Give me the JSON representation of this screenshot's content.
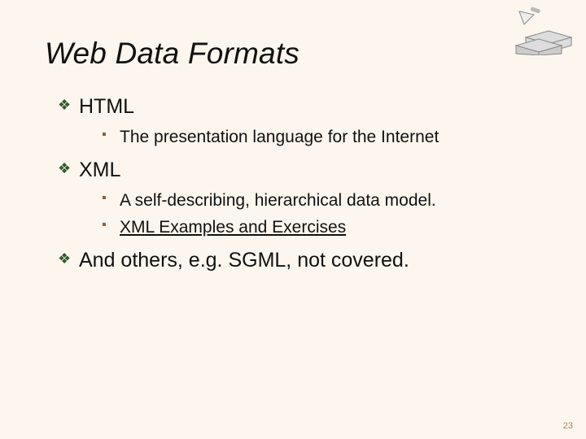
{
  "title": "Web Data Formats",
  "bullets": [
    {
      "text": "HTML",
      "sub": [
        {
          "text": "The presentation language for the Internet"
        }
      ]
    },
    {
      "text": "XML",
      "sub": [
        {
          "text": "A self-describing, hierarchical data model."
        },
        {
          "text": "XML Examples and Exercises",
          "link": true
        }
      ]
    },
    {
      "text": "And others, e.g. SGML, not covered.",
      "sub": []
    }
  ],
  "pageNumber": "23"
}
